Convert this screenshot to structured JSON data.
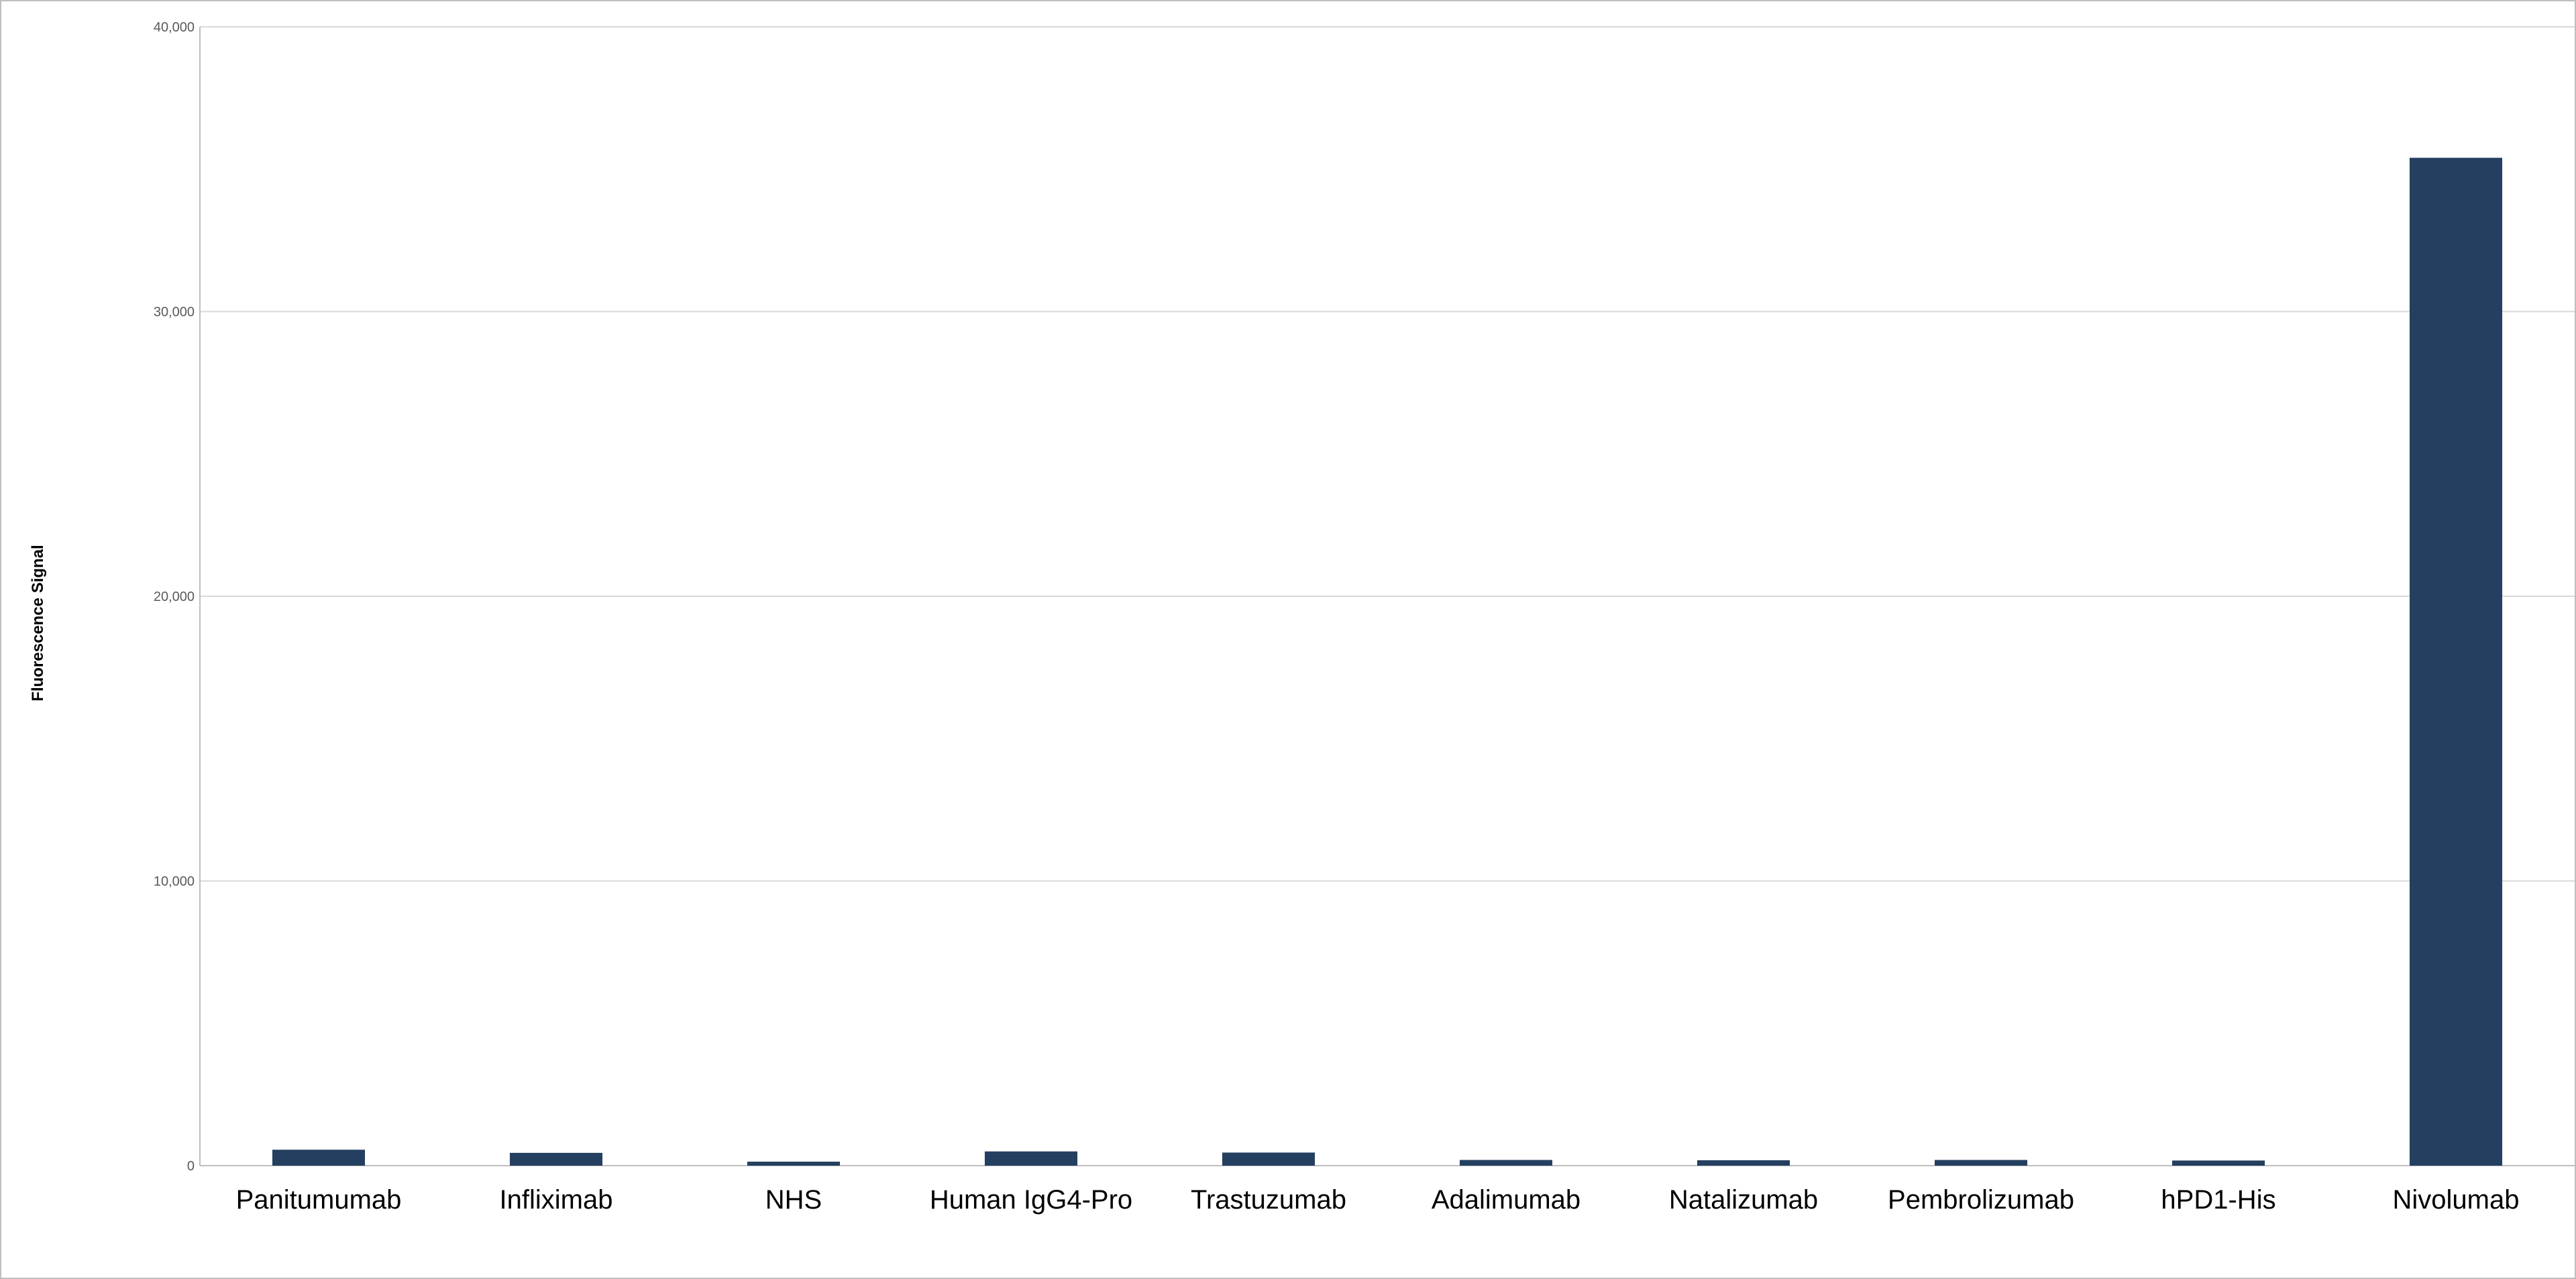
{
  "chart_data": {
    "type": "bar",
    "categories": [
      "Panitumumab",
      "Infliximab",
      "NHS",
      "Human IgG4-Pro",
      "Trastuzumab",
      "Adalimumab",
      "Natalizumab",
      "Pembrolizumab",
      "hPD1-His",
      "Nivolumab"
    ],
    "series": [
      {
        "values": [
          560,
          450,
          140,
          500,
          460,
          200,
          190,
          200,
          180,
          35400
        ],
        "color": "#243f60"
      }
    ],
    "ylabel": "Fluorescence Signal",
    "ylim": [
      0,
      40000
    ],
    "yticks": [
      0,
      10000,
      20000,
      30000,
      40000
    ],
    "ytick_labels": [
      "0",
      "10,000",
      "20,000",
      "30,000",
      "40,000"
    ],
    "grid": true,
    "legend": "none"
  }
}
